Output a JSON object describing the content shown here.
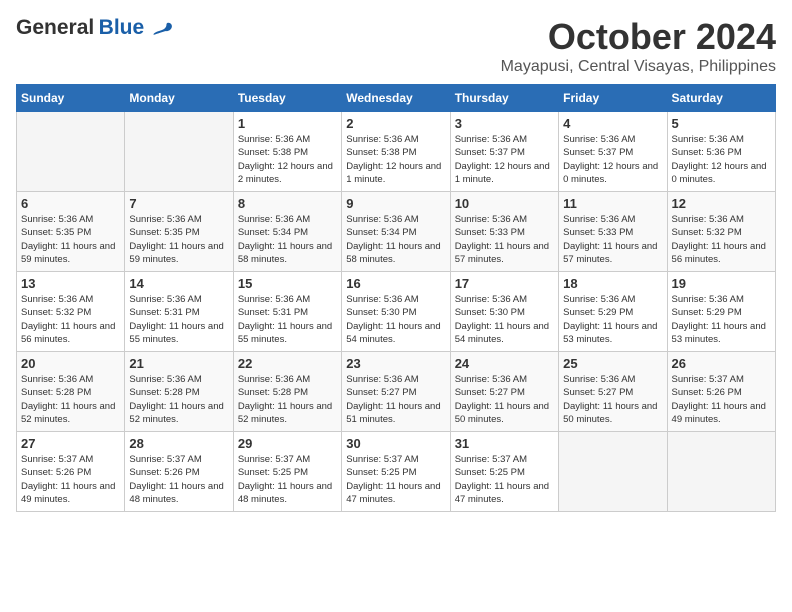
{
  "logo": {
    "line1": "General",
    "line2": "Blue"
  },
  "title": "October 2024",
  "location": "Mayapusi, Central Visayas, Philippines",
  "days_header": [
    "Sunday",
    "Monday",
    "Tuesday",
    "Wednesday",
    "Thursday",
    "Friday",
    "Saturday"
  ],
  "weeks": [
    [
      {
        "day": "",
        "info": ""
      },
      {
        "day": "",
        "info": ""
      },
      {
        "day": "1",
        "sunrise": "Sunrise: 5:36 AM",
        "sunset": "Sunset: 5:38 PM",
        "daylight": "Daylight: 12 hours and 2 minutes."
      },
      {
        "day": "2",
        "sunrise": "Sunrise: 5:36 AM",
        "sunset": "Sunset: 5:38 PM",
        "daylight": "Daylight: 12 hours and 1 minute."
      },
      {
        "day": "3",
        "sunrise": "Sunrise: 5:36 AM",
        "sunset": "Sunset: 5:37 PM",
        "daylight": "Daylight: 12 hours and 1 minute."
      },
      {
        "day": "4",
        "sunrise": "Sunrise: 5:36 AM",
        "sunset": "Sunset: 5:37 PM",
        "daylight": "Daylight: 12 hours and 0 minutes."
      },
      {
        "day": "5",
        "sunrise": "Sunrise: 5:36 AM",
        "sunset": "Sunset: 5:36 PM",
        "daylight": "Daylight: 12 hours and 0 minutes."
      }
    ],
    [
      {
        "day": "6",
        "sunrise": "Sunrise: 5:36 AM",
        "sunset": "Sunset: 5:35 PM",
        "daylight": "Daylight: 11 hours and 59 minutes."
      },
      {
        "day": "7",
        "sunrise": "Sunrise: 5:36 AM",
        "sunset": "Sunset: 5:35 PM",
        "daylight": "Daylight: 11 hours and 59 minutes."
      },
      {
        "day": "8",
        "sunrise": "Sunrise: 5:36 AM",
        "sunset": "Sunset: 5:34 PM",
        "daylight": "Daylight: 11 hours and 58 minutes."
      },
      {
        "day": "9",
        "sunrise": "Sunrise: 5:36 AM",
        "sunset": "Sunset: 5:34 PM",
        "daylight": "Daylight: 11 hours and 58 minutes."
      },
      {
        "day": "10",
        "sunrise": "Sunrise: 5:36 AM",
        "sunset": "Sunset: 5:33 PM",
        "daylight": "Daylight: 11 hours and 57 minutes."
      },
      {
        "day": "11",
        "sunrise": "Sunrise: 5:36 AM",
        "sunset": "Sunset: 5:33 PM",
        "daylight": "Daylight: 11 hours and 57 minutes."
      },
      {
        "day": "12",
        "sunrise": "Sunrise: 5:36 AM",
        "sunset": "Sunset: 5:32 PM",
        "daylight": "Daylight: 11 hours and 56 minutes."
      }
    ],
    [
      {
        "day": "13",
        "sunrise": "Sunrise: 5:36 AM",
        "sunset": "Sunset: 5:32 PM",
        "daylight": "Daylight: 11 hours and 56 minutes."
      },
      {
        "day": "14",
        "sunrise": "Sunrise: 5:36 AM",
        "sunset": "Sunset: 5:31 PM",
        "daylight": "Daylight: 11 hours and 55 minutes."
      },
      {
        "day": "15",
        "sunrise": "Sunrise: 5:36 AM",
        "sunset": "Sunset: 5:31 PM",
        "daylight": "Daylight: 11 hours and 55 minutes."
      },
      {
        "day": "16",
        "sunrise": "Sunrise: 5:36 AM",
        "sunset": "Sunset: 5:30 PM",
        "daylight": "Daylight: 11 hours and 54 minutes."
      },
      {
        "day": "17",
        "sunrise": "Sunrise: 5:36 AM",
        "sunset": "Sunset: 5:30 PM",
        "daylight": "Daylight: 11 hours and 54 minutes."
      },
      {
        "day": "18",
        "sunrise": "Sunrise: 5:36 AM",
        "sunset": "Sunset: 5:29 PM",
        "daylight": "Daylight: 11 hours and 53 minutes."
      },
      {
        "day": "19",
        "sunrise": "Sunrise: 5:36 AM",
        "sunset": "Sunset: 5:29 PM",
        "daylight": "Daylight: 11 hours and 53 minutes."
      }
    ],
    [
      {
        "day": "20",
        "sunrise": "Sunrise: 5:36 AM",
        "sunset": "Sunset: 5:28 PM",
        "daylight": "Daylight: 11 hours and 52 minutes."
      },
      {
        "day": "21",
        "sunrise": "Sunrise: 5:36 AM",
        "sunset": "Sunset: 5:28 PM",
        "daylight": "Daylight: 11 hours and 52 minutes."
      },
      {
        "day": "22",
        "sunrise": "Sunrise: 5:36 AM",
        "sunset": "Sunset: 5:28 PM",
        "daylight": "Daylight: 11 hours and 52 minutes."
      },
      {
        "day": "23",
        "sunrise": "Sunrise: 5:36 AM",
        "sunset": "Sunset: 5:27 PM",
        "daylight": "Daylight: 11 hours and 51 minutes."
      },
      {
        "day": "24",
        "sunrise": "Sunrise: 5:36 AM",
        "sunset": "Sunset: 5:27 PM",
        "daylight": "Daylight: 11 hours and 50 minutes."
      },
      {
        "day": "25",
        "sunrise": "Sunrise: 5:36 AM",
        "sunset": "Sunset: 5:27 PM",
        "daylight": "Daylight: 11 hours and 50 minutes."
      },
      {
        "day": "26",
        "sunrise": "Sunrise: 5:37 AM",
        "sunset": "Sunset: 5:26 PM",
        "daylight": "Daylight: 11 hours and 49 minutes."
      }
    ],
    [
      {
        "day": "27",
        "sunrise": "Sunrise: 5:37 AM",
        "sunset": "Sunset: 5:26 PM",
        "daylight": "Daylight: 11 hours and 49 minutes."
      },
      {
        "day": "28",
        "sunrise": "Sunrise: 5:37 AM",
        "sunset": "Sunset: 5:26 PM",
        "daylight": "Daylight: 11 hours and 48 minutes."
      },
      {
        "day": "29",
        "sunrise": "Sunrise: 5:37 AM",
        "sunset": "Sunset: 5:25 PM",
        "daylight": "Daylight: 11 hours and 48 minutes."
      },
      {
        "day": "30",
        "sunrise": "Sunrise: 5:37 AM",
        "sunset": "Sunset: 5:25 PM",
        "daylight": "Daylight: 11 hours and 47 minutes."
      },
      {
        "day": "31",
        "sunrise": "Sunrise: 5:37 AM",
        "sunset": "Sunset: 5:25 PM",
        "daylight": "Daylight: 11 hours and 47 minutes."
      },
      {
        "day": "",
        "info": ""
      },
      {
        "day": "",
        "info": ""
      }
    ]
  ]
}
